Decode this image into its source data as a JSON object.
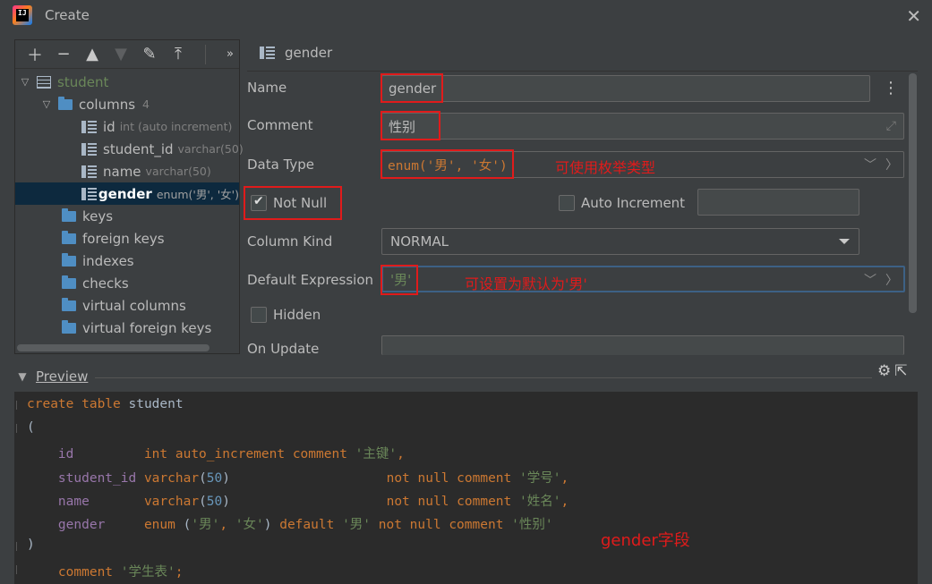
{
  "window": {
    "title": "Create",
    "close_icon": "close-icon"
  },
  "toolbar": {
    "more": "»"
  },
  "tree": {
    "table": "student",
    "columns_label": "columns",
    "columns_count": "4",
    "columns": [
      {
        "name": "id",
        "hint": "int (auto increment)"
      },
      {
        "name": "student_id",
        "hint": "varchar(50)"
      },
      {
        "name": "name",
        "hint": "varchar(50)"
      },
      {
        "name": "gender",
        "hint": "enum('男', '女')"
      }
    ],
    "folders": [
      "keys",
      "foreign keys",
      "indexes",
      "checks",
      "virtual columns",
      "virtual foreign keys"
    ]
  },
  "editor": {
    "header": "gender",
    "name_label": "Name",
    "name_value": "gender",
    "comment_label": "Comment",
    "comment_value": "性别",
    "datatype_label": "Data Type",
    "datatype_value": "enum('男', '女')",
    "datatype_note": "可使用枚举类型",
    "notnull_label": "Not Null",
    "autoinc_label": "Auto Increment",
    "columnkind_label": "Column Kind",
    "columnkind_value": "NORMAL",
    "default_label": "Default Expression",
    "default_value": "'男'",
    "default_note": "可设置为默认为'男'",
    "hidden_label": "Hidden",
    "onupdate_label": "On Update"
  },
  "preview": {
    "label": "Preview",
    "annotation": "gender字段",
    "code": {
      "l1_kw": "create table",
      "l1_name": " student",
      "l2": "(",
      "l3_col": "    id         ",
      "l3_type": "int auto_increment comment ",
      "l3_str": "'主键'",
      "l3_end": ",",
      "l4_col": "    student_id ",
      "l4_type": "varchar",
      "l4_p1": "(",
      "l4_num": "50",
      "l4_p2": ")                    ",
      "l4_kw": "not null comment ",
      "l4_str": "'学号'",
      "l4_end": ",",
      "l5_col": "    name       ",
      "l5_type": "varchar",
      "l5_p1": "(",
      "l5_num": "50",
      "l5_p2": ")                    ",
      "l5_kw": "not null comment ",
      "l5_str": "'姓名'",
      "l5_end": ",",
      "l6_col": "    gender     ",
      "l6_type": "enum ",
      "l6_p1": "(",
      "l6_s1": "'男'",
      "l6_c": ", ",
      "l6_s2": "'女'",
      "l6_p2": ") ",
      "l6_kw1": "default ",
      "l6_s3": "'男'",
      "l6_kw2": " not null comment ",
      "l6_s4": "'性别'",
      "l7": ")",
      "l8_kw": "    comment ",
      "l8_str": "'学生表'",
      "l8_end": ";"
    }
  },
  "colors": {
    "annotation_red": "#e01b1b",
    "selection": "#0d293e",
    "keyword": "#cc7832",
    "string": "#6a8759"
  }
}
